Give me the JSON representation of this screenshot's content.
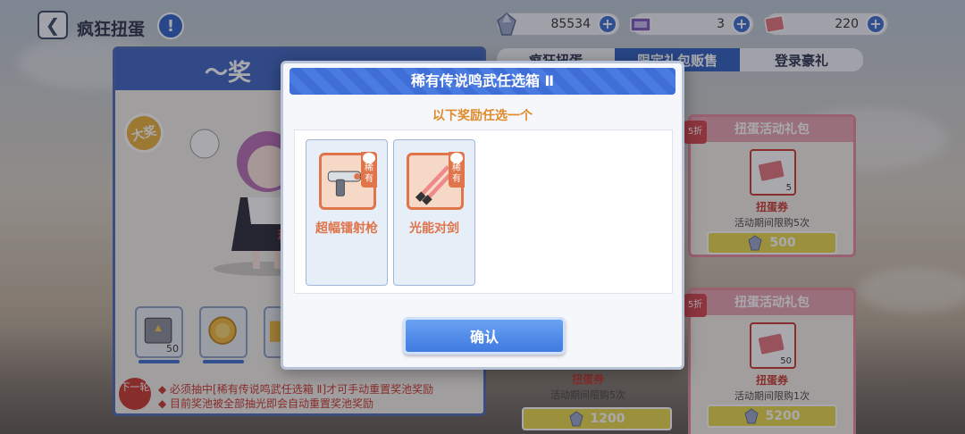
{
  "header": {
    "title": "疯狂扭蛋"
  },
  "resources": [
    {
      "icon": "crystal-icon",
      "value": "85534"
    },
    {
      "icon": "ticket-card-icon",
      "value": "3"
    },
    {
      "icon": "gacha-ticket-icon",
      "value": "220"
    }
  ],
  "tabs": [
    {
      "label": "疯狂扭蛋",
      "active": false
    },
    {
      "label": "限定礼包贩售",
      "active": true
    },
    {
      "label": "登录豪礼",
      "active": false
    }
  ],
  "left_panel": {
    "title": "～奖",
    "badge": "大奖",
    "side_char": "稀",
    "rewards": [
      {
        "icon": "loot-box-icon",
        "count": "50"
      },
      {
        "icon": "gold-coin-icon",
        "count": ""
      },
      {
        "icon": "reward-icon",
        "count": ""
      }
    ],
    "next_round": "下一轮",
    "notes": [
      "◆ 必须抽中[稀有传说鸣武任选箱 Ⅱ]才可手动重置奖池奖励",
      "◆ 目前奖池被全部抽光即会自动重置奖池奖励"
    ]
  },
  "gifts": [
    {
      "discount": "5折",
      "title": "扭蛋活动礼包",
      "item": "扭蛋券",
      "count": "5",
      "limit": "活动期间限购5次",
      "price": "500"
    },
    {
      "discount": "5折",
      "title": "扭蛋活动礼包",
      "item": "扭蛋券",
      "count": "50",
      "limit": "活动期间限购1次",
      "price": "5200"
    }
  ],
  "under_modal_gift": {
    "item": "扭蛋券",
    "limit": "活动期间限购5次",
    "price": "1200"
  },
  "modal": {
    "title": "稀有传说鸣武任选箱 Ⅱ",
    "subtitle": "以下奖励任选一个",
    "choices": [
      {
        "name": "超幅镭射枪",
        "rarity": "稀有",
        "icon": "laser-gun-icon"
      },
      {
        "name": "光能对剑",
        "rarity": "稀有",
        "icon": "energy-swords-icon"
      }
    ],
    "confirm_label": "确认"
  },
  "colors": {
    "accent": "#3f7ae0",
    "rare": "#e0744a",
    "warning": "#c8372e"
  }
}
